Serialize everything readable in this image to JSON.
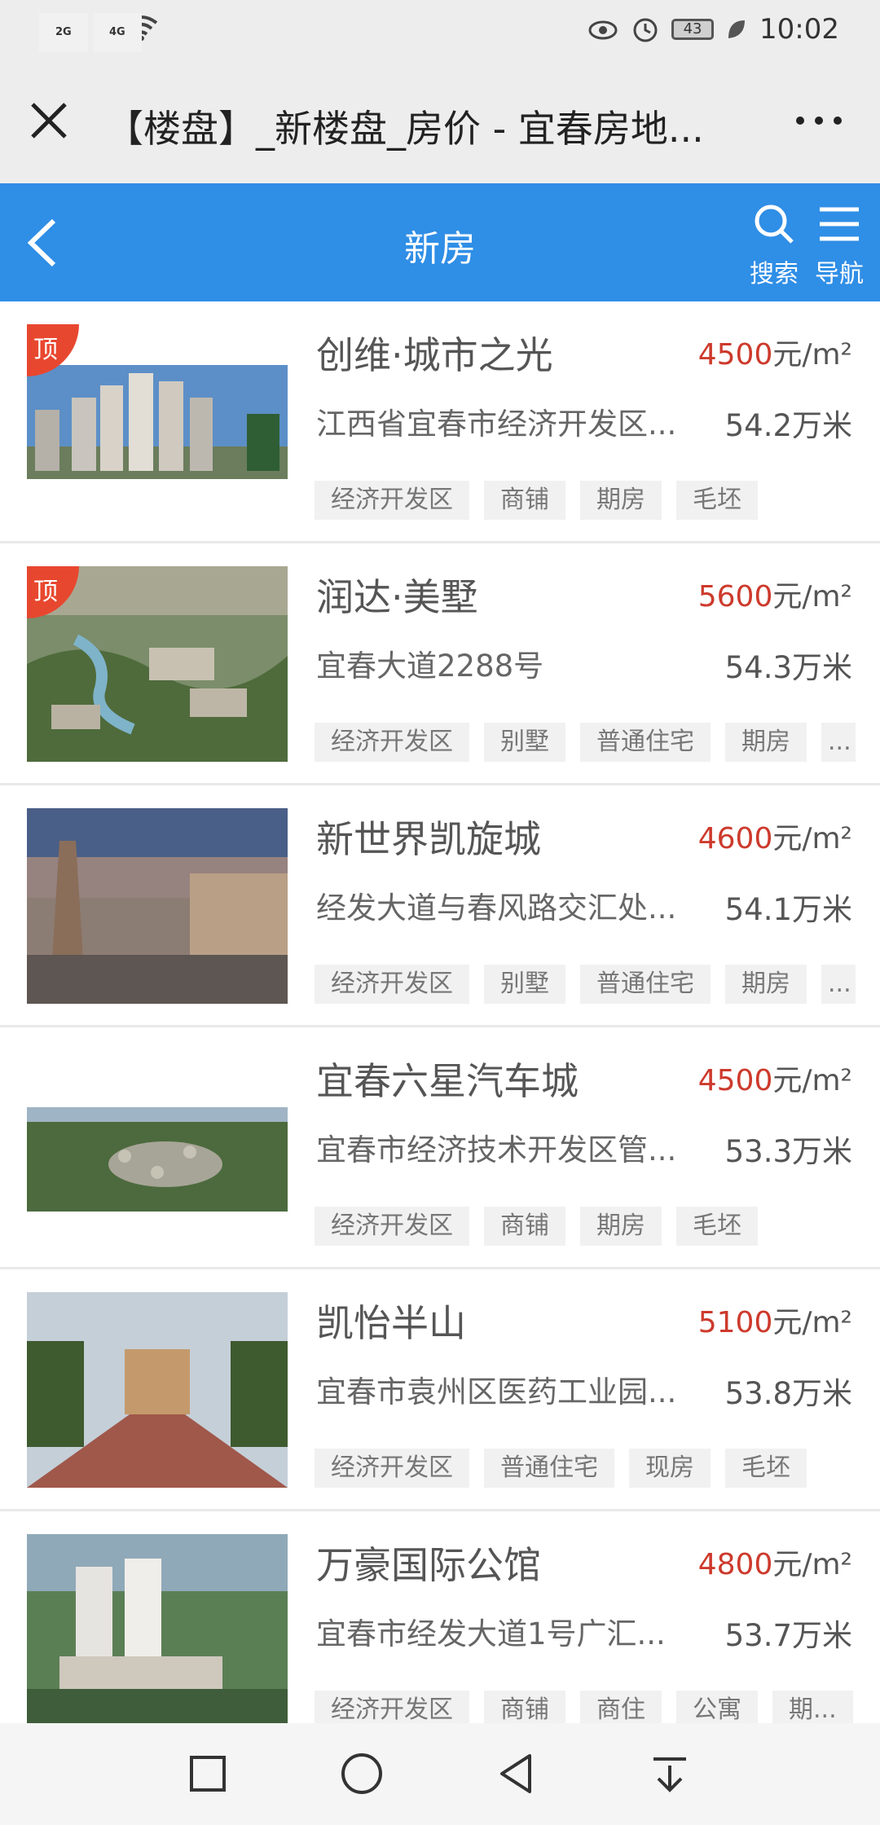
{
  "status_bar": {
    "signal1_tag": "2G",
    "signal2_tag": "4G",
    "battery": "43",
    "time": "10:02"
  },
  "title_bar": {
    "title": "【楼盘】_新楼盘_房价 - 宜春房地..."
  },
  "header": {
    "title": "新房",
    "search_label": "搜索",
    "nav_label": "导航",
    "color": "#2f8ee6"
  },
  "listings": [
    {
      "name": "创维·城市之光",
      "price": "4500",
      "unit": "元/m²",
      "address": "江西省宜春市经济开发区...",
      "distance": "54.2万米",
      "top": "顶",
      "tags": [
        "经济开发区",
        "商铺",
        "期房",
        "毛坯"
      ]
    },
    {
      "name": "润达·美墅",
      "price": "5600",
      "unit": "元/m²",
      "address": "宜春大道2288号",
      "distance": "54.3万米",
      "top": "顶",
      "tags": [
        "经济开发区",
        "别墅",
        "普通住宅",
        "期房",
        "..."
      ]
    },
    {
      "name": "新世界凯旋城",
      "price": "4600",
      "unit": "元/m²",
      "address": "经发大道与春风路交汇处...",
      "distance": "54.1万米",
      "top": "",
      "tags": [
        "经济开发区",
        "别墅",
        "普通住宅",
        "期房",
        "..."
      ]
    },
    {
      "name": "宜春六星汽车城",
      "price": "4500",
      "unit": "元/m²",
      "address": "宜春市经济技术开发区管...",
      "distance": "53.3万米",
      "top": "",
      "tags": [
        "经济开发区",
        "商铺",
        "期房",
        "毛坯"
      ]
    },
    {
      "name": "凯怡半山",
      "price": "5100",
      "unit": "元/m²",
      "address": "宜春市袁州区医药工业园...",
      "distance": "53.8万米",
      "top": "",
      "tags": [
        "经济开发区",
        "普通住宅",
        "现房",
        "毛坯"
      ]
    },
    {
      "name": "万豪国际公馆",
      "price": "4800",
      "unit": "元/m²",
      "address": "宜春市经发大道1号广汇...",
      "distance": "53.7万米",
      "top": "",
      "tags": [
        "经济开发区",
        "商铺",
        "商住",
        "公寓",
        "期..."
      ]
    }
  ],
  "colors": {
    "price": "#cd3a2c",
    "badge": "#e8472f"
  },
  "nav_icons": [
    "square-icon",
    "circle-icon",
    "triangle-back-icon",
    "download-icon"
  ]
}
